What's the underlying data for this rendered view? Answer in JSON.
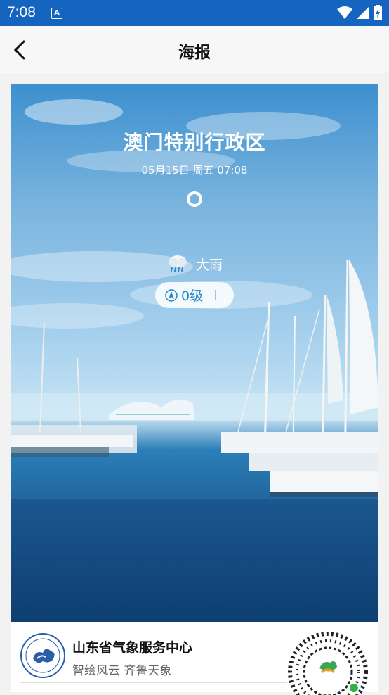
{
  "status_bar": {
    "time": "7:08",
    "notification_badge": "A"
  },
  "app_bar": {
    "title": "海报"
  },
  "poster": {
    "city": "澳门特别行政区",
    "datetime": "05月15日 周五 07:08",
    "weather": "大雨",
    "wind_level": "0级"
  },
  "footer": {
    "org_name": "山东省气象服务中心",
    "slogan": "智绘风云 齐鲁天象"
  },
  "colors": {
    "status_bar": "#1565c0",
    "accent": "#1e88c8"
  }
}
